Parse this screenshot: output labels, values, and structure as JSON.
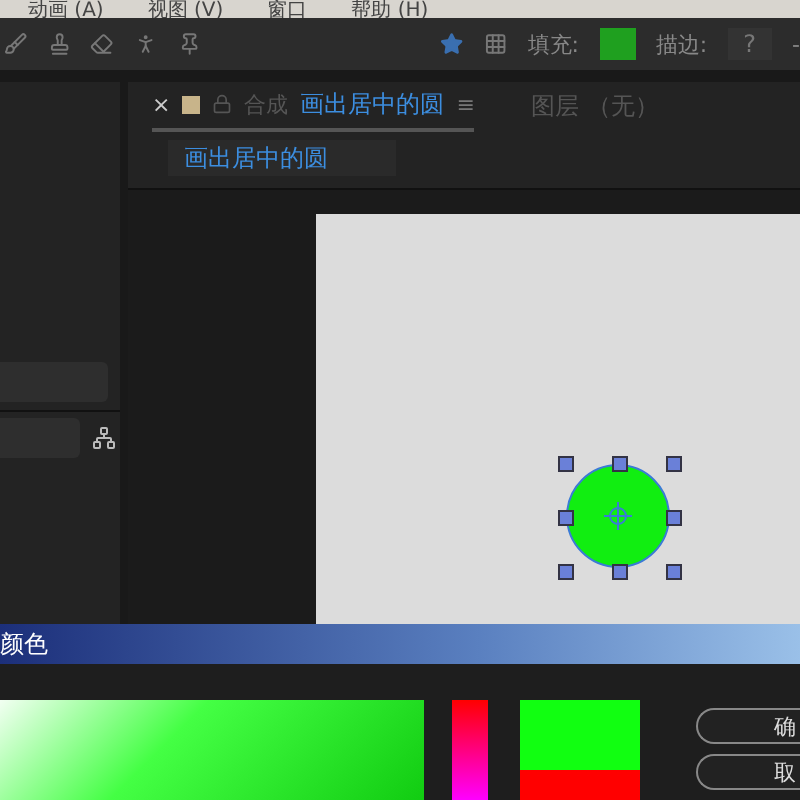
{
  "menu_bar": {
    "items": [
      "动画 (A)",
      "视图 (V)",
      "窗口",
      "帮助 (H)"
    ]
  },
  "toolbar": {
    "fill_label": "填充:",
    "stroke_label": "描边:",
    "stroke_value": "?",
    "trailing": "-"
  },
  "composition_panel": {
    "close": "×",
    "prefix": "合成",
    "tab_title": "画出居中的圆",
    "tab_selected": true,
    "menu": "≡",
    "layer_label": "图层 （无）",
    "breadcrumb": "画出居中的圆"
  },
  "canvas": {
    "selected": true
  },
  "color_dialog": {
    "title": "颜色",
    "buttons": [
      "确",
      "取"
    ]
  }
}
